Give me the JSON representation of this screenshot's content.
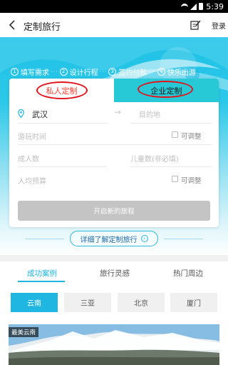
{
  "status_bar": {
    "time": "5:39"
  },
  "nav": {
    "title": "定制旅行",
    "login_label": "登录"
  },
  "steps": [
    {
      "num": "1",
      "label": "填写需求"
    },
    {
      "num": "2",
      "label": "设计行程"
    },
    {
      "num": "3",
      "label": "签约付款"
    },
    {
      "num": "4",
      "label": "快乐出游"
    }
  ],
  "card": {
    "tab_private": "私人定制",
    "tab_enterprise": "企业定制",
    "origin": "武汉",
    "destination_placeholder": "目的地",
    "travel_time_placeholder": "游玩时间",
    "adjustable_label": "可调整",
    "adults_placeholder": "成人数",
    "children_placeholder": "儿童数(非必填)",
    "budget_placeholder": "人均预算",
    "submit_label": "开启新的旅程"
  },
  "learn_more_label": "详细了解定制旅行",
  "categories": [
    {
      "label": "成功案例",
      "active": true
    },
    {
      "label": "旅行灵感",
      "active": false
    },
    {
      "label": "热门周边",
      "active": false
    }
  ],
  "regions": [
    {
      "label": "云南",
      "active": true
    },
    {
      "label": "三亚",
      "active": false
    },
    {
      "label": "北京",
      "active": false
    },
    {
      "label": "厦门",
      "active": false
    }
  ],
  "photo_tag": "最美云南",
  "colors": {
    "accent": "#1fb7e2",
    "annotation_red": "#e0141c",
    "enterprise_tab": "#28c9d6"
  }
}
